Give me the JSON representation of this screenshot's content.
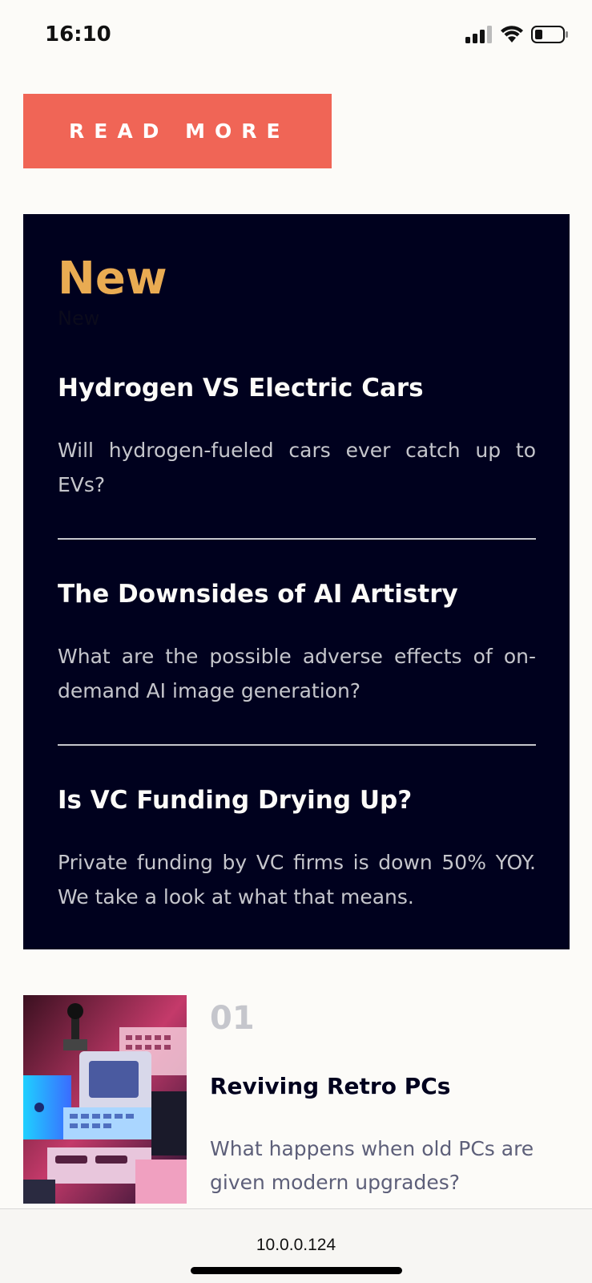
{
  "status_bar": {
    "time": "16:10",
    "icons": [
      "signal-icon",
      "wifi-icon",
      "battery-icon"
    ]
  },
  "read_more": {
    "label": "READ MORE"
  },
  "new_section": {
    "heading": "New",
    "heading_shadow": "New",
    "articles": [
      {
        "title": "Hydrogen VS Electric Cars",
        "description": "Will hydrogen-fueled cars ever catch up to EVs?"
      },
      {
        "title": "The Downsides of AI Artistry",
        "description": "What are the possible adverse effects of on-demand AI image generation?"
      },
      {
        "title": "Is VC Funding Drying Up?",
        "description": "Private funding by VC firms is down 50% YOY. We take a look at what that means."
      }
    ]
  },
  "top_list": {
    "items": [
      {
        "number": "01",
        "title": "Reviving Retro PCs",
        "description": "What happens when old PCs are given modern upgrades?",
        "image_icon": "retro-pc-image"
      }
    ]
  },
  "browser": {
    "url": "10.0.0.124"
  },
  "colors": {
    "accent_red": "#f06556",
    "panel_dark": "#00011e",
    "heading_orange": "#e9ab52",
    "muted_text": "#c5c6cc",
    "body_text": "#5d5f79",
    "background": "#fcfbf8"
  }
}
